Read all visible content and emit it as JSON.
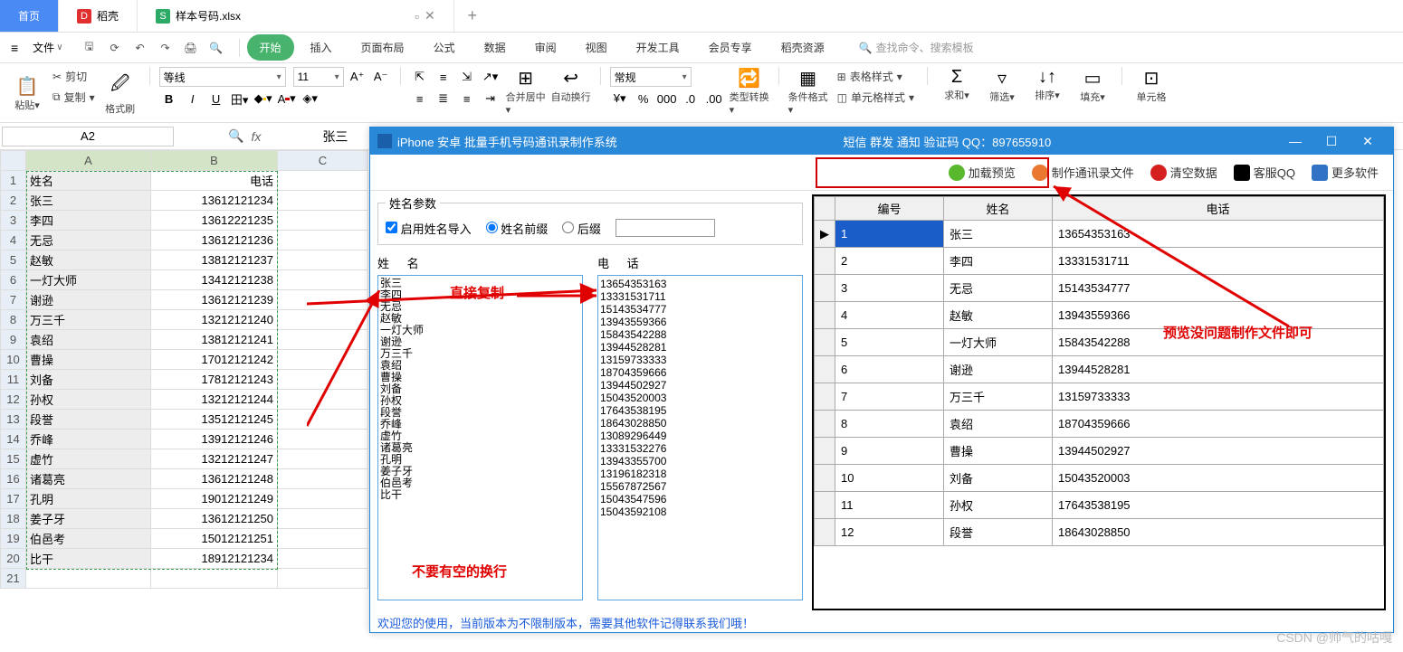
{
  "tabs": {
    "home": "首页",
    "daoke": "稻壳",
    "file": "样本号码.xlsx"
  },
  "menu": {
    "file": "文件",
    "items": [
      "开始",
      "插入",
      "页面布局",
      "公式",
      "数据",
      "审阅",
      "视图",
      "开发工具",
      "会员专享",
      "稻壳资源"
    ],
    "search": "查找命令、搜索模板"
  },
  "ribbon": {
    "paste": "粘贴",
    "cut": "剪切",
    "copy": "复制",
    "format_painter": "格式刷",
    "font": "等线",
    "size": "11",
    "merge": "合并居中",
    "wrap": "自动换行",
    "general": "常规",
    "type_convert": "类型转换",
    "cond_format": "条件格式",
    "table_style": "表格样式",
    "cell_style": "单元格样式",
    "sum": "求和",
    "filter": "筛选",
    "sort": "排序",
    "fill": "填充",
    "cell": "单元格"
  },
  "namebox": "A2",
  "formula": "张三",
  "sheet": {
    "headers": [
      "姓名",
      "电话"
    ],
    "rows": [
      [
        "张三",
        "13612121234"
      ],
      [
        "李四",
        "13612221235"
      ],
      [
        "无忌",
        "13612121236"
      ],
      [
        "赵敏",
        "13812121237"
      ],
      [
        "一灯大师",
        "13412121238"
      ],
      [
        "谢逊",
        "13612121239"
      ],
      [
        "万三千",
        "13212121240"
      ],
      [
        "袁绍",
        "13812121241"
      ],
      [
        "曹操",
        "17012121242"
      ],
      [
        "刘备",
        "17812121243"
      ],
      [
        "孙权",
        "13212121244"
      ],
      [
        "段誉",
        "13512121245"
      ],
      [
        "乔峰",
        "13912121246"
      ],
      [
        "虚竹",
        "13212121247"
      ],
      [
        "诸葛亮",
        "13612121248"
      ],
      [
        "孔明",
        "19012121249"
      ],
      [
        "姜子牙",
        "13612121250"
      ],
      [
        "伯邑考",
        "15012121251"
      ],
      [
        "比干",
        "18912121234"
      ]
    ]
  },
  "app": {
    "title_left": "iPhone 安卓 批量手机号码通讯录制作系统",
    "title_right": "短信 群发 通知 验证码  QQ：897655910",
    "tb": {
      "load": "加载预览",
      "make": "制作通讯录文件",
      "clear": "清空数据",
      "qq": "客服QQ",
      "more": "更多软件"
    },
    "fieldset": "姓名参数",
    "enable_import": "启用姓名导入",
    "prefix": "姓名前缀",
    "suffix": "后缀",
    "col_name": "姓 名",
    "col_phone": "电 话",
    "names": [
      "张三",
      "李四",
      "无忌",
      "赵敏",
      "一灯大师",
      "谢逊",
      "万三千",
      "袁绍",
      "曹操",
      "刘备",
      "孙权",
      "段誉",
      "乔峰",
      "虚竹",
      "诸葛亮",
      "孔明",
      "姜子牙",
      "伯邑考",
      "比干"
    ],
    "phones": [
      "13654353163",
      "13331531711",
      "15143534777",
      "13943559366",
      "15843542288",
      "13944528281",
      "13159733333",
      "18704359666",
      "13944502927",
      "15043520003",
      "17643538195",
      "18643028850",
      "13089296449",
      "13331532276",
      "13943355700",
      "13196182318",
      "15567872567",
      "15043547596",
      "15043592108"
    ],
    "grid_headers": [
      "编号",
      "姓名",
      "电话"
    ],
    "grid": [
      [
        "1",
        "张三",
        "13654353163"
      ],
      [
        "2",
        "李四",
        "13331531711"
      ],
      [
        "3",
        "无忌",
        "15143534777"
      ],
      [
        "4",
        "赵敏",
        "13943559366"
      ],
      [
        "5",
        "一灯大师",
        "15843542288"
      ],
      [
        "6",
        "谢逊",
        "13944528281"
      ],
      [
        "7",
        "万三千",
        "13159733333"
      ],
      [
        "8",
        "袁绍",
        "18704359666"
      ],
      [
        "9",
        "曹操",
        "13944502927"
      ],
      [
        "10",
        "刘备",
        "15043520003"
      ],
      [
        "11",
        "孙权",
        "17643538195"
      ],
      [
        "12",
        "段誉",
        "18643028850"
      ]
    ],
    "status": "欢迎您的使用，当前版本为不限制版本，需要其他软件记得联系我们哦！"
  },
  "anno": {
    "copy": "直接复制",
    "no_blank": "不要有空的换行",
    "preview_ok": "预览没问题制作文件即可"
  },
  "watermark": "CSDN @帅气的咕嘎"
}
